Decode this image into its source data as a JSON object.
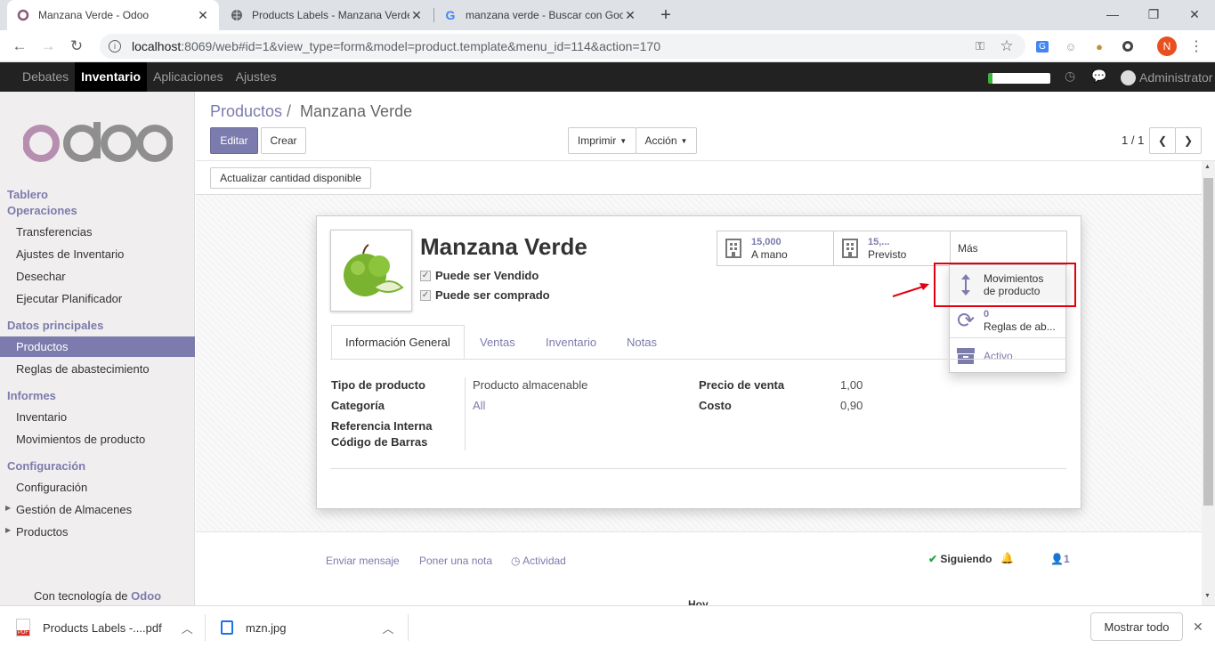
{
  "browser": {
    "tabs": [
      {
        "title": "Manzana Verde - Odoo"
      },
      {
        "title": "Products Labels - Manzana Verde"
      },
      {
        "title": "manzana verde - Buscar con Google"
      }
    ],
    "new_tab": "+",
    "url_host": "localhost",
    "url_rest": ":8069/web#id=1&view_type=form&model=product.template&menu_id=114&action=170",
    "profile_initial": "N"
  },
  "topnav": {
    "items": [
      "Debates",
      "Inventario",
      "Aplicaciones",
      "Ajustes"
    ],
    "user": "Administrator"
  },
  "sidebar": {
    "logo": "odoo",
    "section_tablero": "Tablero",
    "section_operaciones": "Operaciones",
    "operaciones": [
      "Transferencias",
      "Ajustes de Inventario",
      "Desechar",
      "Ejecutar Planificador"
    ],
    "section_datos": "Datos principales",
    "datos": [
      "Productos",
      "Reglas de abastecimiento"
    ],
    "section_informes": "Informes",
    "informes": [
      "Inventario",
      "Movimientos de producto"
    ],
    "section_config": "Configuración",
    "config": [
      "Configuración",
      "Gestión de Almacenes",
      "Productos"
    ],
    "powered_prefix": "Con tecnología de",
    "powered_brand": "Odoo"
  },
  "control": {
    "breadcrumb_parent": "Productos",
    "breadcrumb_sep": "/",
    "breadcrumb_current": "Manzana Verde",
    "edit": "Editar",
    "create": "Crear",
    "print": "Imprimir",
    "action": "Acción",
    "pager": "1 / 1",
    "update_qty": "Actualizar cantidad disponible"
  },
  "product": {
    "name": "Manzana Verde",
    "can_sell": "Puede ser Vendido",
    "can_purchase": "Puede ser comprado",
    "stat_onhand_value": "15,000",
    "stat_onhand_label": "A mano",
    "stat_forecast_value": "15,...",
    "stat_forecast_label": "Previsto",
    "more": "Más",
    "dropdown": {
      "moves_line1": "Movimientos",
      "moves_line2": "de producto",
      "rules_count": "0",
      "rules_label": "Reglas de ab...",
      "active": "Activo"
    },
    "tabs": [
      "Información General",
      "Ventas",
      "Inventario",
      "Notas"
    ],
    "fields": {
      "tipo_label": "Tipo de producto",
      "tipo_value": "Producto almacenable",
      "categoria_label": "Categoría",
      "categoria_value": "All",
      "referencia_label": "Referencia Interna",
      "barras_label": "Código de Barras",
      "precio_label": "Precio de venta",
      "precio_value": "1,00",
      "costo_label": "Costo",
      "costo_value": "0,90"
    }
  },
  "chatter": {
    "send": "Enviar mensaje",
    "note": "Poner una nota",
    "activity": "Actividad",
    "following": "Siguiendo",
    "followers": "1",
    "today": "Hoy"
  },
  "downloads": {
    "items": [
      "Products Labels -....pdf",
      "mzn.jpg"
    ],
    "show_all": "Mostrar todo"
  },
  "colors": {
    "accent": "#7c7bad",
    "highlight": "#e0000f",
    "topbar": "#222222"
  }
}
